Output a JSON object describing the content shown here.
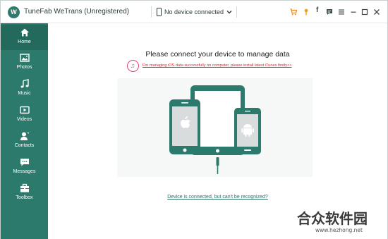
{
  "app": {
    "title": "TuneFab WeTrans (Unregistered)",
    "logo_letter": "W"
  },
  "device": {
    "status": "No device connected"
  },
  "toolbar": {
    "facebook_label": "f"
  },
  "icons": [
    "cart-icon",
    "key-icon",
    "facebook-icon",
    "feedback-icon",
    "menu-icon",
    "minimize-icon",
    "maximize-icon",
    "close-icon"
  ],
  "sidebar": {
    "items": [
      {
        "label": "Home",
        "icon": "home-icon",
        "active": true
      },
      {
        "label": "Photos",
        "icon": "photos-icon"
      },
      {
        "label": "Music",
        "icon": "music-icon"
      },
      {
        "label": "Videos",
        "icon": "videos-icon"
      },
      {
        "label": "Contacts",
        "icon": "contacts-icon"
      },
      {
        "label": "Messages",
        "icon": "messages-icon"
      },
      {
        "label": "Toolbox",
        "icon": "toolbox-icon"
      }
    ]
  },
  "main": {
    "headline": "Please connect your device to manage data",
    "itunes_notice": "For managing iOS data successfully on computer, please install latest iTunes firstly>>",
    "help_link": "Device is connected, but can't be recognized?"
  },
  "watermark": {
    "logo": "合众软件园",
    "url": "www.hezhong.net"
  },
  "colors": {
    "brand": "#2b7a6b",
    "brand_dark": "#236a5c",
    "notice_red": "#e0242a"
  }
}
